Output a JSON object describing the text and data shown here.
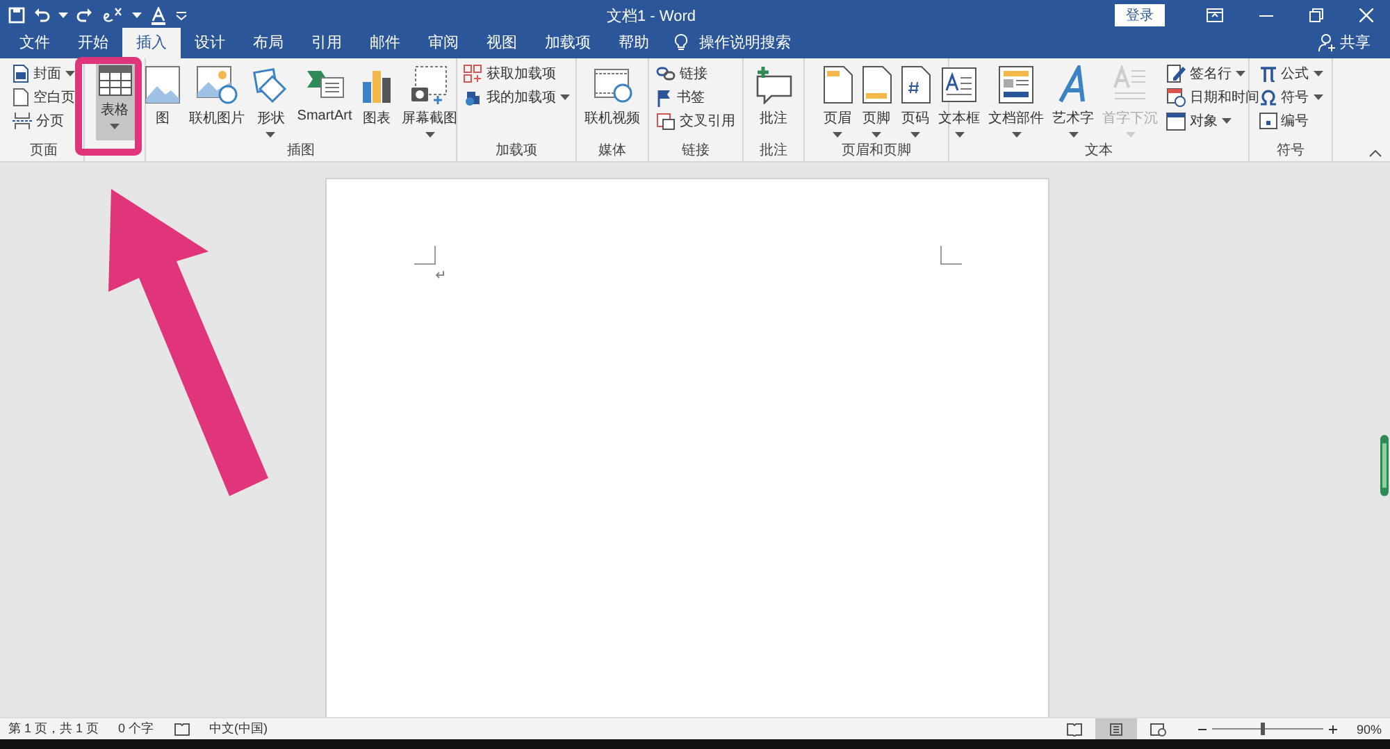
{
  "window": {
    "title": "文档1 - Word",
    "sign_in": "登录"
  },
  "menu_tabs": [
    {
      "label": "文件",
      "selected": false
    },
    {
      "label": "开始",
      "selected": false
    },
    {
      "label": "插入",
      "selected": true
    },
    {
      "label": "设计",
      "selected": false
    },
    {
      "label": "布局",
      "selected": false
    },
    {
      "label": "引用",
      "selected": false
    },
    {
      "label": "邮件",
      "selected": false
    },
    {
      "label": "审阅",
      "selected": false
    },
    {
      "label": "视图",
      "selected": false
    },
    {
      "label": "加载项",
      "selected": false
    },
    {
      "label": "帮助",
      "selected": false
    }
  ],
  "tell_me": "操作说明搜索",
  "share": "共享",
  "ribbon_groups": [
    {
      "label": "页面",
      "items": [
        {
          "kind": "small",
          "label": "封面",
          "dropdown": true,
          "selected": false,
          "disabled": false
        },
        {
          "kind": "small",
          "label": "空白页",
          "dropdown": false,
          "selected": false,
          "disabled": false
        },
        {
          "kind": "small",
          "label": "分页",
          "dropdown": false,
          "selected": false,
          "disabled": false
        }
      ]
    },
    {
      "items": [
        {
          "kind": "large",
          "label": "表格",
          "dropdown": true,
          "selected": true,
          "disabled": false
        }
      ]
    },
    {
      "label": "插图",
      "items": [
        {
          "kind": "large",
          "label": "图",
          "dropdown": false,
          "selected": false,
          "disabled": false
        },
        {
          "kind": "large",
          "label": "联机图片",
          "dropdown": false,
          "selected": false,
          "disabled": false
        },
        {
          "kind": "large",
          "label": "形状",
          "dropdown": true,
          "selected": false,
          "disabled": false
        },
        {
          "kind": "large",
          "label": "SmartArt",
          "dropdown": false,
          "selected": false,
          "disabled": false
        },
        {
          "kind": "large",
          "label": "图表",
          "dropdown": false,
          "selected": false,
          "disabled": false
        },
        {
          "kind": "large",
          "label": "屏幕截图",
          "dropdown": true,
          "selected": false,
          "disabled": false
        }
      ]
    },
    {
      "label": "加载项",
      "items": [
        {
          "kind": "small",
          "label": "获取加载项",
          "dropdown": false,
          "selected": false,
          "disabled": false
        },
        {
          "kind": "small",
          "label": "我的加载项",
          "dropdown": true,
          "selected": false,
          "disabled": false
        }
      ]
    },
    {
      "label": "媒体",
      "items": [
        {
          "kind": "large",
          "label": "联机视频",
          "dropdown": false,
          "selected": false,
          "disabled": false
        }
      ]
    },
    {
      "label": "链接",
      "items": [
        {
          "kind": "small",
          "label": "链接",
          "dropdown": false,
          "selected": false,
          "disabled": false
        },
        {
          "kind": "small",
          "label": "书签",
          "dropdown": false,
          "selected": false,
          "disabled": false
        },
        {
          "kind": "small",
          "label": "交叉引用",
          "dropdown": false,
          "selected": false,
          "disabled": false
        }
      ]
    },
    {
      "label": "批注",
      "items": [
        {
          "kind": "large",
          "label": "批注",
          "dropdown": false,
          "selected": false,
          "disabled": false
        }
      ]
    },
    {
      "label": "页眉和页脚",
      "items": [
        {
          "kind": "large",
          "label": "页眉",
          "dropdown": true,
          "selected": false,
          "disabled": false
        },
        {
          "kind": "large",
          "label": "页脚",
          "dropdown": true,
          "selected": false,
          "disabled": false
        },
        {
          "kind": "large",
          "label": "页码",
          "dropdown": true,
          "selected": false,
          "disabled": false
        }
      ]
    },
    {
      "label": "文本",
      "items": [
        {
          "kind": "large",
          "label": "文本框",
          "dropdown": true,
          "selected": false,
          "disabled": false
        },
        {
          "kind": "large",
          "label": "文档部件",
          "dropdown": true,
          "selected": false,
          "disabled": false
        },
        {
          "kind": "large",
          "label": "艺术字",
          "dropdown": true,
          "selected": false,
          "disabled": false
        },
        {
          "kind": "large",
          "label": "首字下沉",
          "dropdown": true,
          "selected": false,
          "disabled": true
        },
        {
          "kind": "small",
          "label": "签名行",
          "dropdown": true,
          "selected": false,
          "disabled": false
        },
        {
          "kind": "small",
          "label": "日期和时间",
          "dropdown": false,
          "selected": false,
          "disabled": false
        },
        {
          "kind": "small",
          "label": "对象",
          "dropdown": true,
          "selected": false,
          "disabled": false
        }
      ]
    },
    {
      "label": "符号",
      "items": [
        {
          "kind": "small",
          "label": "公式",
          "dropdown": true,
          "selected": false,
          "disabled": false
        },
        {
          "kind": "small",
          "label": "符号",
          "dropdown": true,
          "selected": false,
          "disabled": false
        },
        {
          "kind": "small",
          "label": "编号",
          "dropdown": false,
          "selected": false,
          "disabled": false
        }
      ]
    }
  ],
  "status_bar": {
    "page": "第 1 页，共 1 页",
    "words": "0 个字",
    "language": "中文(中国)",
    "views": [
      {
        "selected": false
      },
      {
        "selected": true
      },
      {
        "selected": false
      }
    ],
    "zoom": {
      "level": 0.45,
      "reading": "90%"
    }
  }
}
